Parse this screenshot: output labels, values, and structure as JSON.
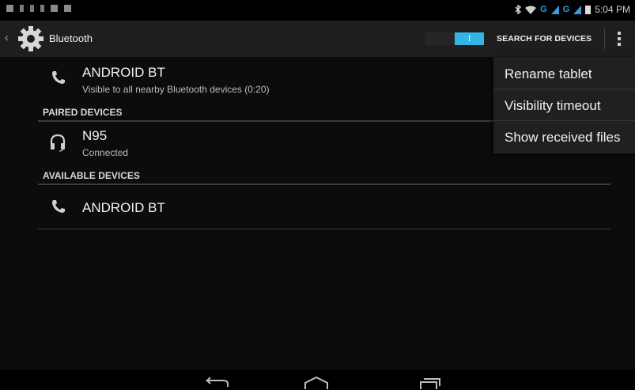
{
  "status_bar": {
    "time": "5:04 PM",
    "network_labels": [
      "G",
      "G"
    ],
    "icons": [
      "notification-icon",
      "usb-icon",
      "usb-debug-icon",
      "sd-icon",
      "notification-icon",
      "notification-icon",
      "bluetooth-icon",
      "wifi-icon",
      "signal-icon",
      "signal-icon",
      "battery-icon"
    ]
  },
  "action_bar": {
    "title": "Bluetooth",
    "toggle_label": "I",
    "toggle_state": "on",
    "search_label": "SEARCH FOR DEVICES",
    "accent_color": "#33b5e5"
  },
  "this_device": {
    "name": "ANDROID BT",
    "status": "Visible to all nearby Bluetooth devices (0:20)",
    "icon": "phone-icon"
  },
  "paired": {
    "header": "PAIRED DEVICES",
    "devices": [
      {
        "name": "N95",
        "status": "Connected",
        "icon": "headset-icon"
      }
    ]
  },
  "available": {
    "header": "AVAILABLE DEVICES",
    "devices": [
      {
        "name": "ANDROID BT",
        "icon": "phone-icon"
      }
    ]
  },
  "overflow_menu": {
    "items": [
      "Rename tablet",
      "Visibility timeout",
      "Show received files"
    ]
  },
  "nav_bar": {
    "buttons": [
      "back-icon",
      "home-icon",
      "recent-apps-icon"
    ]
  }
}
